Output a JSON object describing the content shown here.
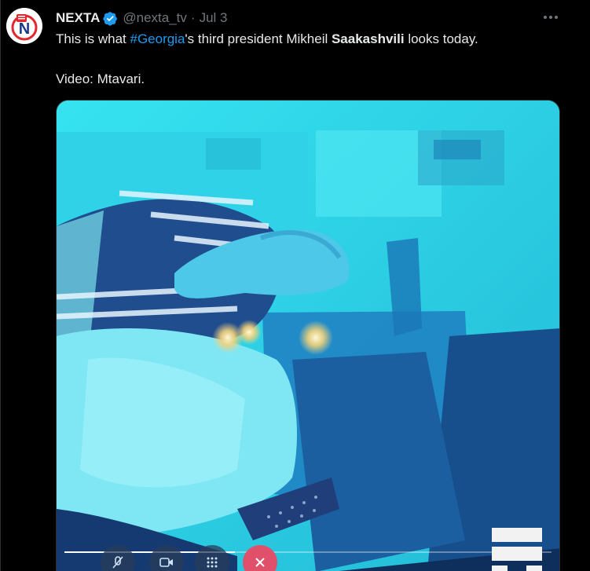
{
  "tweet": {
    "author": {
      "display_name": "NEXTA",
      "handle": "@nexta_tv",
      "separator": "·",
      "date": "Jul 3",
      "avatar_letter": "N"
    },
    "text": {
      "part1": "This is what ",
      "hashtag": "#Georgia",
      "part2": "'s third president Mikheil ",
      "bold": "Saakashvili",
      "part3": " looks today.",
      "line2": "Video: Mtavari."
    },
    "icons": {
      "verified": "verified-badge-icon",
      "more": "more-options-icon"
    },
    "video": {
      "progress": 0.35,
      "controls": [
        "mic-off-icon",
        "camera-icon",
        "keypad-icon",
        "hang-up-icon"
      ],
      "watermark": "mtavari-logo"
    }
  },
  "colors": {
    "background": "#000000",
    "text": "#e7e9ea",
    "muted": "#71767b",
    "accent": "#1d9bf0",
    "video_tint": "#2fd8e8"
  }
}
